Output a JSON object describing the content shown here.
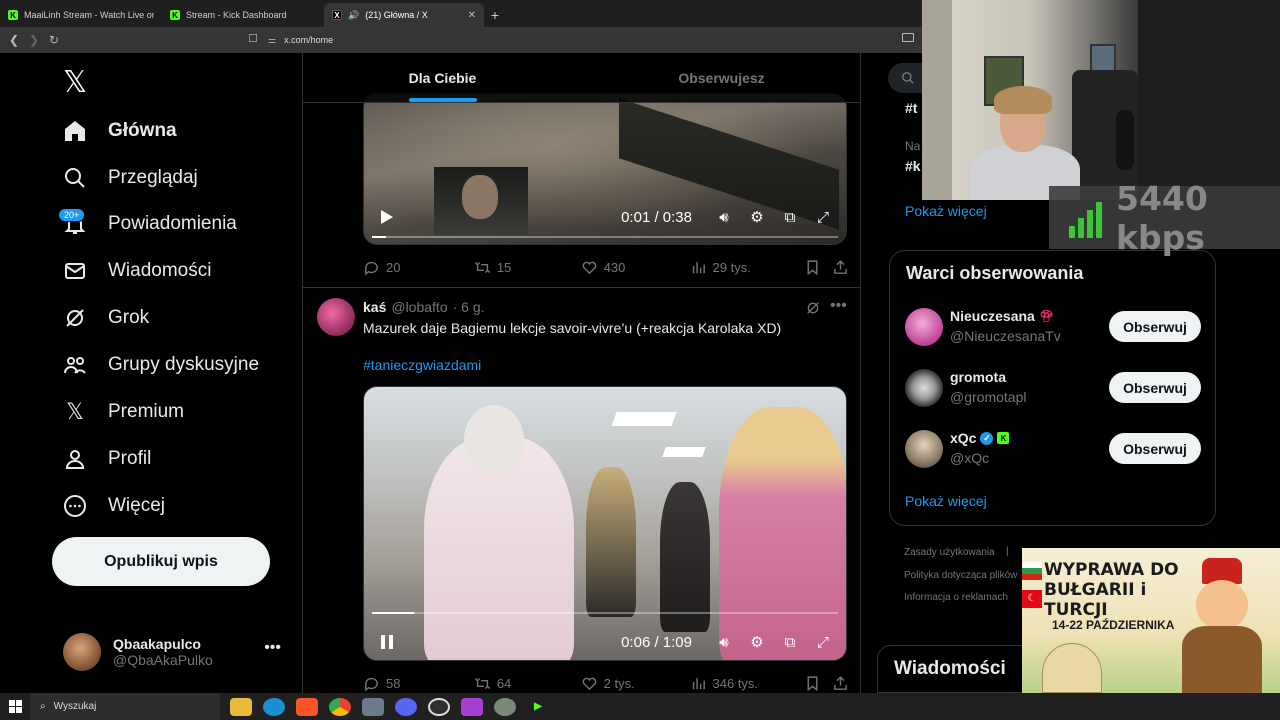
{
  "browser": {
    "tabs": [
      {
        "title": "MaaiLinh Stream - Watch Live on"
      },
      {
        "title": "Stream - Kick Dashboard"
      },
      {
        "title": "(21) Główna / X"
      }
    ],
    "url": "x.com/home"
  },
  "nav": {
    "items": [
      {
        "label": "Główna",
        "icon": "home-icon"
      },
      {
        "label": "Przeglądaj",
        "icon": "search-icon"
      },
      {
        "label": "Powiadomienia",
        "icon": "bell-icon",
        "badge": "20+"
      },
      {
        "label": "Wiadomości",
        "icon": "mail-icon"
      },
      {
        "label": "Grok",
        "icon": "grok-icon"
      },
      {
        "label": "Grupy dyskusyjne",
        "icon": "communities-icon"
      },
      {
        "label": "Premium",
        "icon": "x-premium-icon"
      },
      {
        "label": "Profil",
        "icon": "profile-icon"
      },
      {
        "label": "Więcej",
        "icon": "more-circle-icon"
      }
    ],
    "publish_label": "Opublikuj wpis",
    "account": {
      "name": "Qbaakapulco",
      "handle": "@QbaAkaPulko"
    }
  },
  "feed": {
    "tabs": [
      "Dla Ciebie",
      "Obserwujesz"
    ],
    "post1": {
      "time": "0:01 / 0:38",
      "progress": 0.03,
      "replies": "20",
      "reposts": "15",
      "likes": "430",
      "views": "29 tys."
    },
    "post2": {
      "name": "kaś",
      "handle": "@lobafto",
      "time_ago": "· 6 g.",
      "text": "Mazurek daje Bagiemu lekcje savoir-vivre’u (+reakcja Karolaka XD)",
      "hashtag": "#tanieczgwiazdami",
      "video_time": "0:06 / 1:09",
      "progress": 0.09,
      "replies": "58",
      "reposts": "64",
      "likes": "2 tys.",
      "views": "346 tys."
    }
  },
  "right": {
    "trend_frag1": "#t",
    "trend_na": "Na",
    "trend_frag2": "#k",
    "show_more": "Pokaż więcej",
    "who_to_follow": {
      "title": "Warci obserwowania",
      "button": "Obserwuj",
      "accounts": [
        {
          "name": "Nieuczesana",
          "handle": "@NieuczesanaTv"
        },
        {
          "name": "gromota",
          "handle": "@gromotapl"
        },
        {
          "name": "xQc",
          "handle": "@xQc"
        }
      ],
      "show_more": "Pokaż więcej"
    },
    "footer": [
      "Zasady użytkowania",
      "Polityka dotycząca plików",
      "Informacja o reklamach"
    ],
    "messages": "Wiadomości"
  },
  "overlay": {
    "bitrate": "5440 kbps",
    "promo_title": "WYPRAWA DO BUŁGARII i TURCJI",
    "promo_dates": "14-22 PAŹDZIERNIKA"
  },
  "taskbar": {
    "search_label": "Wyszukaj"
  },
  "colors": {
    "accent": "#1d9bf0",
    "kick": "#53fc18",
    "bg": "#000000"
  }
}
